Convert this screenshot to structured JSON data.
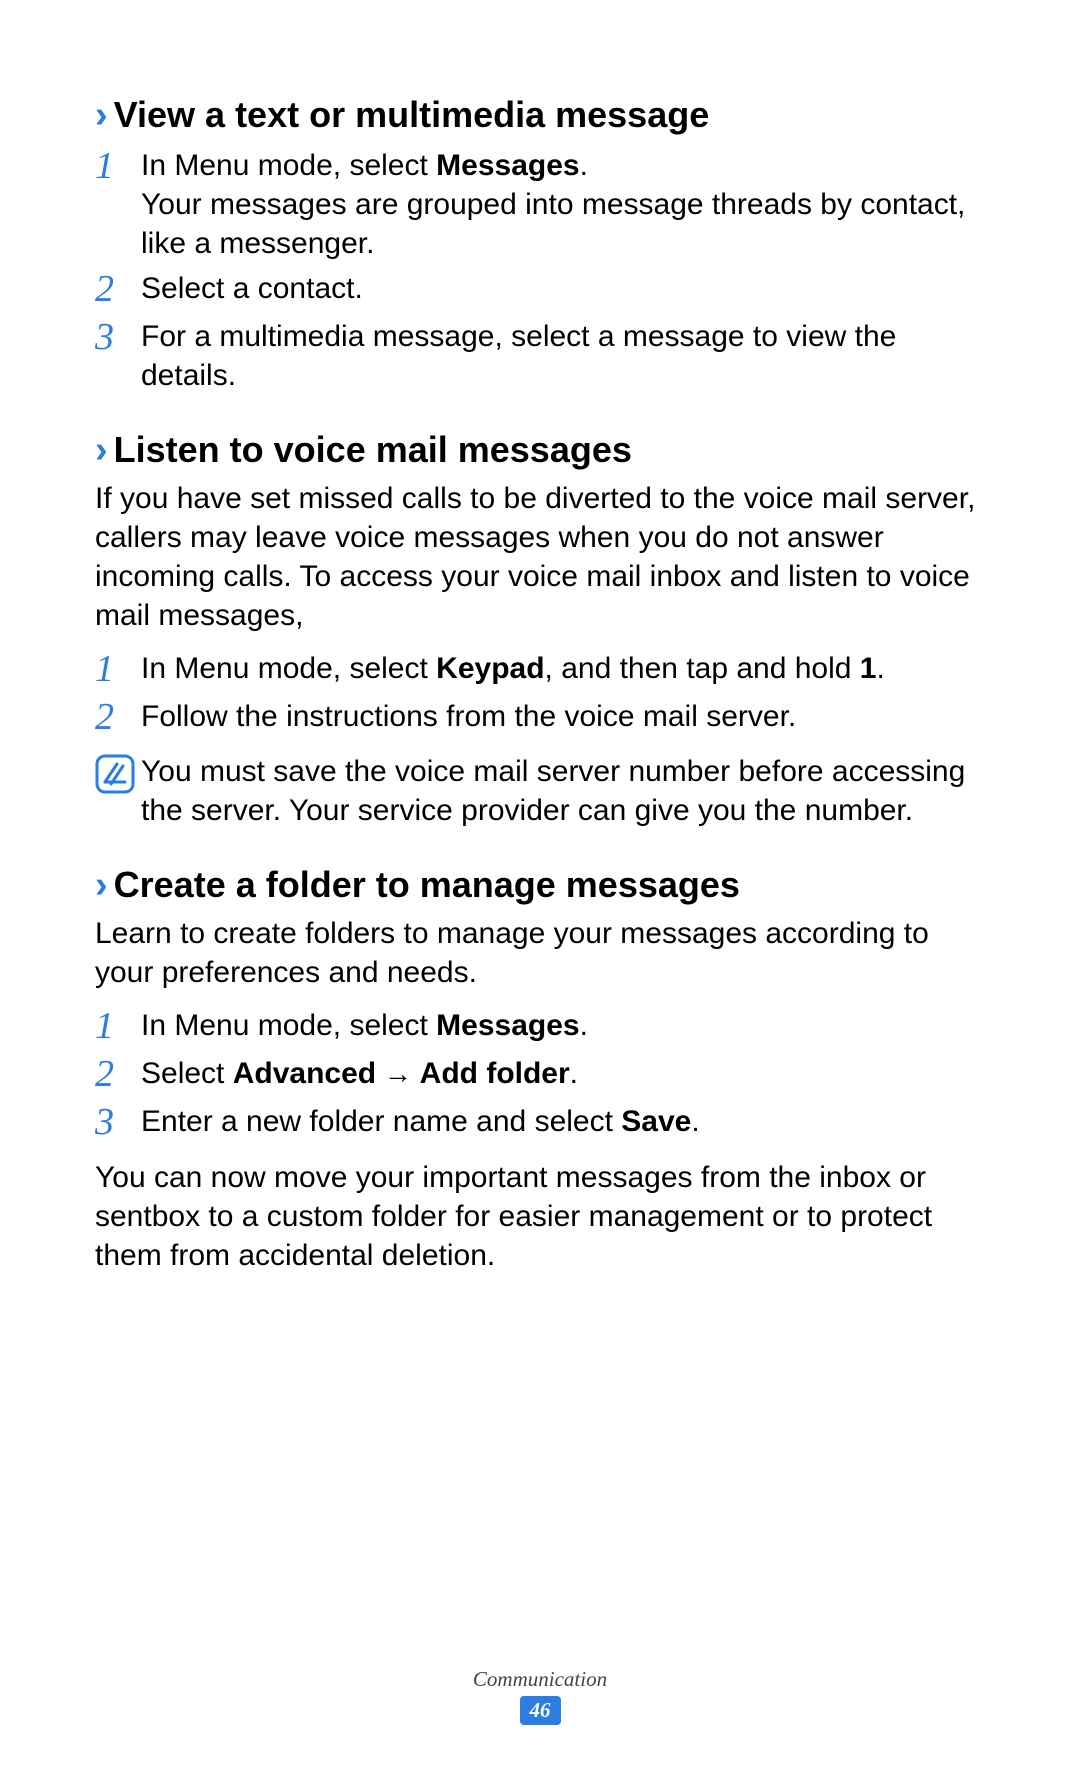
{
  "sections": [
    {
      "title": "View a text or multimedia message",
      "steps": [
        {
          "num": "1",
          "pre": "In Menu mode, select ",
          "bold": "Messages",
          "post": ".",
          "extra": "Your messages are grouped into message threads by contact, like a messenger."
        },
        {
          "num": "2",
          "pre": "Select a contact.",
          "bold": "",
          "post": ""
        },
        {
          "num": "3",
          "pre": "For a multimedia message, select a message to view the details.",
          "bold": "",
          "post": ""
        }
      ]
    },
    {
      "title": "Listen to voice mail messages",
      "intro": "If you have set missed calls to be diverted to the voice mail server, callers may leave voice messages when you do not answer incoming calls. To access your voice mail inbox and listen to voice mail messages,",
      "steps": [
        {
          "num": "1",
          "pre": "In Menu mode, select ",
          "bold": "Keypad",
          "post": ", and then tap and hold ",
          "bold2": "1",
          "post2": "."
        },
        {
          "num": "2",
          "pre": "Follow the instructions from the voice mail server.",
          "bold": "",
          "post": ""
        }
      ],
      "note": "You must save the voice mail server number before accessing the server. Your service provider can give you the number."
    },
    {
      "title": "Create a folder to manage messages",
      "intro": "Learn to create folders to manage your messages according to your preferences and needs.",
      "steps": [
        {
          "num": "1",
          "pre": "In Menu mode, select ",
          "bold": "Messages",
          "post": "."
        },
        {
          "num": "2",
          "pre": "Select ",
          "bold": "Advanced",
          "arrow": " → ",
          "bold2": "Add folder",
          "post2": "."
        },
        {
          "num": "3",
          "pre": "Enter a new folder name and select ",
          "bold": "Save",
          "post": "."
        }
      ],
      "outro": "You can now move your important messages from the inbox or sentbox to a custom folder for easier management or to protect them from accidental deletion."
    }
  ],
  "footer": {
    "label": "Communication",
    "page": "46"
  },
  "chevron": "›"
}
